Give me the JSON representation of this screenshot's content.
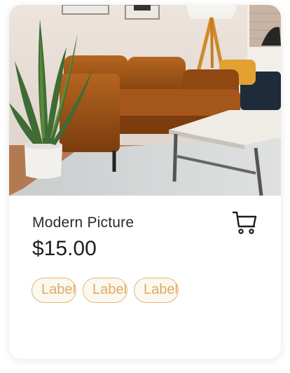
{
  "product": {
    "title": "Modern Picture",
    "price": "$15.00",
    "tags": [
      "Label",
      "Label",
      "Label"
    ]
  },
  "icons": {
    "cart": "shopping-cart-icon"
  },
  "colors": {
    "tag_border": "#e0b77a",
    "tag_text": "#e0a966",
    "tag_background": "#fbf9ef"
  }
}
